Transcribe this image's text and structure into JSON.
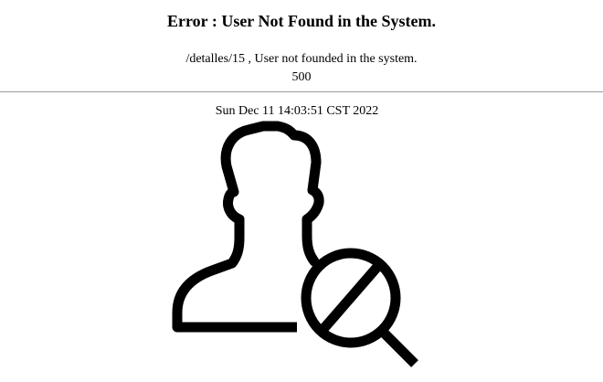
{
  "error": {
    "title": "Error : User Not Found in the System.",
    "path_message": "/detalles/15 , User not founded in the system.",
    "status_code": "500",
    "timestamp": "Sun Dec 11 14:03:51 CST 2022"
  },
  "illustration": {
    "icon": "user-not-found-icon",
    "color": "#000000"
  }
}
